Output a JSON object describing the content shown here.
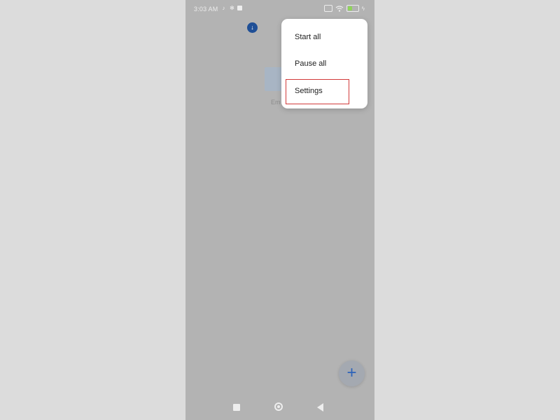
{
  "status_bar": {
    "time": "3:03 AM",
    "icons": [
      "tiktok-icon",
      "gear-icon",
      "app-icon"
    ],
    "right_icons": [
      "sim-icon",
      "wifi-icon",
      "battery-icon",
      "charge-icon"
    ],
    "battery_level": 0.45,
    "battery_color": "#8fd45a"
  },
  "download_badge_icon": "arrow-down-icon",
  "empty_state": {
    "text_fragment": "Em"
  },
  "menu": {
    "items": [
      {
        "label": "Start all"
      },
      {
        "label": "Pause all"
      },
      {
        "label": "Settings"
      }
    ],
    "highlighted_item": "Settings",
    "highlight_color": "#d23a3a"
  },
  "fab": {
    "symbol": "+",
    "color": "#2d63b9"
  },
  "nav_bar": {
    "buttons": [
      "recents-icon",
      "home-icon",
      "back-icon"
    ]
  }
}
